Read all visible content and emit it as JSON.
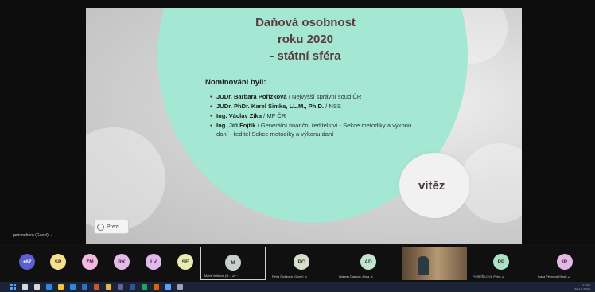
{
  "slide": {
    "title_lines": [
      "Daňová osobnost",
      "roku 2020",
      "- státní sféra"
    ],
    "nominees_heading": "Nominováni byli:",
    "nominees": [
      {
        "name": "JUDr. Barbara Pořízková",
        "role": " / Nejvyšší správní soud ČR"
      },
      {
        "name": "JUDr. PhDr. Karel Šimka, LL.M., Ph.D.",
        "role": " / NSS"
      },
      {
        "name": "Ing. Václav  Zíka",
        "role": " / MF ČR"
      },
      {
        "name": "Ing. Jiří Fojtík",
        "role": " / Generální finanční ředitelství - Sekce metodiky a výkonu daní - ředitel Sekce metodiky a výkonu daní"
      }
    ],
    "winner_label": "vítěz",
    "prezi_label": "Prezi"
  },
  "presenter": {
    "name": "pemmehuro (Guest) ⊿"
  },
  "participants": [
    {
      "initials": "+67",
      "color": "#5c5ed4",
      "text_color": "#ffffff",
      "label": ""
    },
    {
      "initials": "SP",
      "color": "#f4e08e",
      "text_color": "#3a2a2a",
      "label": ""
    },
    {
      "initials": "ŽM",
      "color": "#f2b9e3",
      "text_color": "#3a2a2a",
      "label": ""
    },
    {
      "initials": "RK",
      "color": "#e5b9ea",
      "text_color": "#3a2a2a",
      "label": ""
    },
    {
      "initials": "LV",
      "color": "#e4b7ef",
      "text_color": "#3a2a2a",
      "label": ""
    },
    {
      "initials": "ŠE",
      "color": "#e7ecb0",
      "text_color": "#3a2a2a",
      "label": ""
    },
    {
      "initials": "M",
      "color": "#c7d0cf",
      "text_color": "#3a2a2a",
      "label": "Marie Vaňková (G... ⊿ ···",
      "selected": true
    },
    {
      "initials": "PČ",
      "color": "#d6dfc9",
      "text_color": "#3a2a2a",
      "label": "Petra Čiváková (Guest) ⊿"
    },
    {
      "initials": "AD",
      "color": "#bfe5cf",
      "text_color": "#3a2a2a",
      "label": "Wagner Dagmar, Anna ⊿"
    },
    {
      "initials": "",
      "color": "",
      "text_color": "",
      "label": "",
      "camera": true
    },
    {
      "initials": "PP",
      "color": "#a9e3c4",
      "text_color": "#3a2a2a",
      "label": "POSPÍŠILOVÁ Petra ⊿"
    },
    {
      "initials": "IP",
      "color": "#e3b7e6",
      "text_color": "#3a2a2a",
      "label": "Ivana Pěknová (Host) ⊿"
    }
  ],
  "taskbar": {
    "icons": [
      "search-icon",
      "taskview-icon",
      "edge-icon",
      "explorer-icon",
      "mail-icon",
      "outlook-icon",
      "powerpoint-icon",
      "chrome-icon",
      "teams-icon",
      "word-icon",
      "excel-icon",
      "firefox-icon",
      "store-icon",
      "settings-icon"
    ],
    "icon_colors": [
      "#d8d8d8",
      "#d8d8d8",
      "#2d88e8",
      "#f3c342",
      "#2d88e8",
      "#2f6fd1",
      "#d35230",
      "#e9b83b",
      "#6264a7",
      "#2b579a",
      "#21a366",
      "#e66000",
      "#5aa0ff",
      "#9aa4b8"
    ],
    "time": "17:57",
    "date": "29.10.2020"
  }
}
